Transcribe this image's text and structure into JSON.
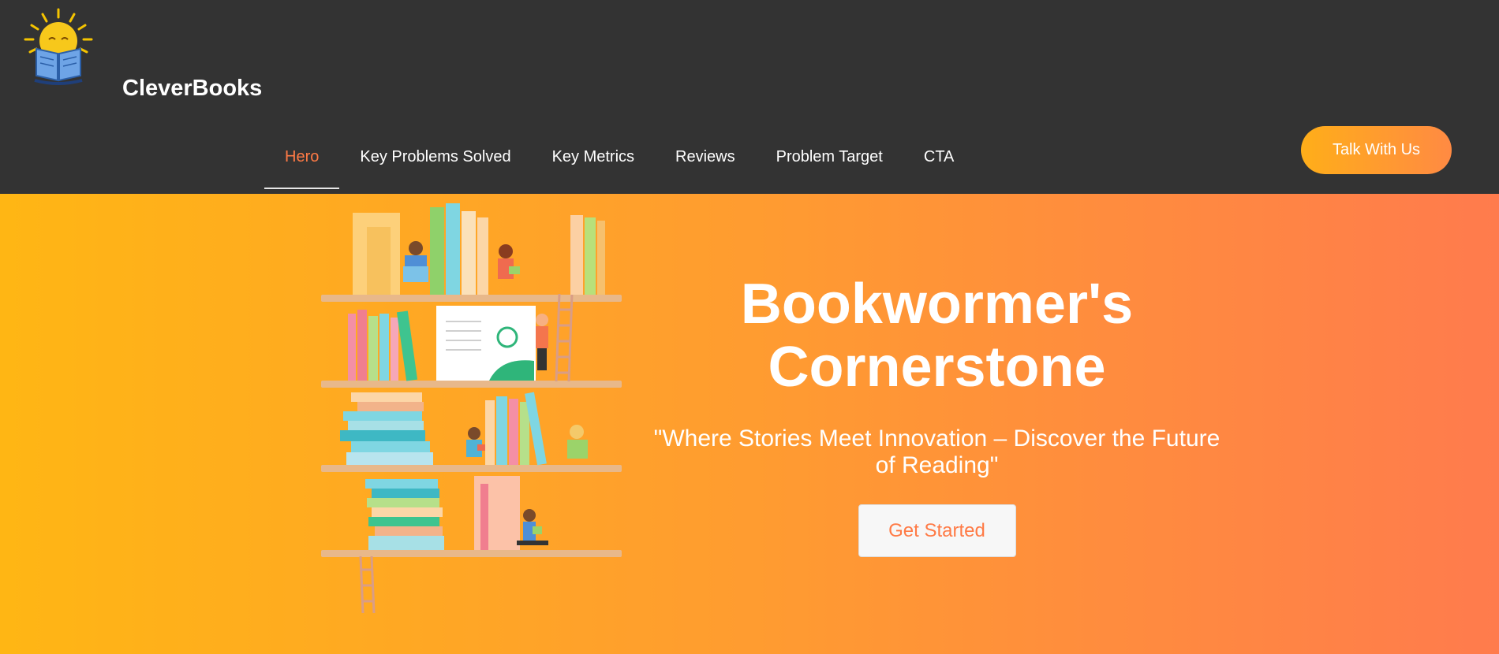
{
  "brand": {
    "name": "CleverBooks"
  },
  "nav": {
    "items": [
      {
        "label": "Hero",
        "active": true
      },
      {
        "label": "Key Problems Solved",
        "active": false
      },
      {
        "label": "Key Metrics",
        "active": false
      },
      {
        "label": "Reviews",
        "active": false
      },
      {
        "label": "Problem Target",
        "active": false
      },
      {
        "label": "CTA",
        "active": false
      }
    ],
    "cta_label": "Talk With Us"
  },
  "hero": {
    "title_line1": "Bookwormer's",
    "title_line2": "Cornerstone",
    "subtitle": "\"Where Stories Meet Innovation – Discover the Future of Reading\"",
    "button_label": "Get Started"
  },
  "colors": {
    "header_bg": "#333333",
    "accent": "#ff7a45",
    "hero_gradient_start": "#ffb614",
    "hero_gradient_end": "#ff7b4d"
  },
  "icons": {
    "logo": "sun-reading-book-icon",
    "illustration": "bookshelf-kids-reading-illustration"
  }
}
